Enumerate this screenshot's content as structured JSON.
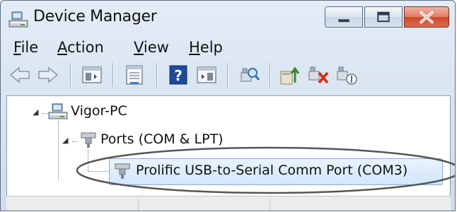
{
  "window": {
    "title": "Device Manager"
  },
  "menubar": {
    "items": [
      {
        "id": "file",
        "accel": "F",
        "rest": "ile"
      },
      {
        "id": "action",
        "accel": "A",
        "rest": "ction"
      },
      {
        "id": "view",
        "accel": "V",
        "rest": "iew"
      },
      {
        "id": "help",
        "accel": "H",
        "rest": "elp"
      }
    ]
  },
  "toolbar": {
    "buttons": [
      "back-arrow-icon",
      "forward-arrow-icon",
      "show-hide-console-tree-icon",
      "properties-icon",
      "help-icon",
      "show-action-pane-icon",
      "scan-for-hardware-changes-icon",
      "update-driver-icon",
      "uninstall-icon",
      "disable-device-icon"
    ]
  },
  "tree": {
    "root": {
      "label": "Vigor-PC",
      "expanded": true
    },
    "ports": {
      "label": "Ports (COM & LPT)",
      "expanded": true
    },
    "device": {
      "label": "Prolific USB-to-Serial Comm Port (COM3)",
      "selected": true
    }
  },
  "colors": {
    "window_frame": "#5f6f86",
    "close_button": "#cd4a2c",
    "selection": "#d2e6fb",
    "annotation_ellipse": "#555555"
  }
}
